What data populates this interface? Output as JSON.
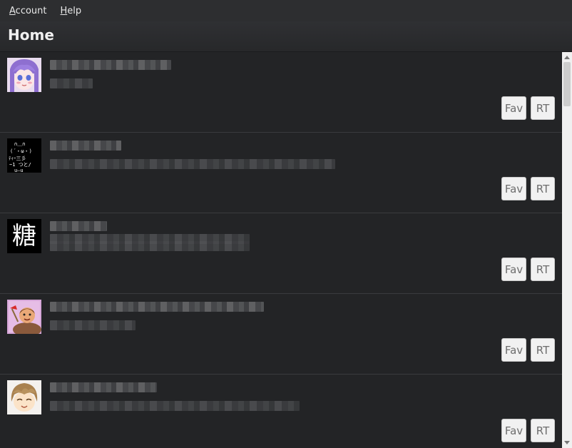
{
  "menu": {
    "account": {
      "accel": "A",
      "rest": "ccount"
    },
    "help": {
      "accel": "H",
      "rest": "elp"
    }
  },
  "page": {
    "title": "Home"
  },
  "buttons": {
    "fav": "Fav",
    "rt": "RT"
  },
  "avatar_text": {
    "kanji": "糖"
  },
  "colors": {
    "background": "#232426",
    "button": "#f1f1f1",
    "accent_text": "#f0f0f0"
  }
}
